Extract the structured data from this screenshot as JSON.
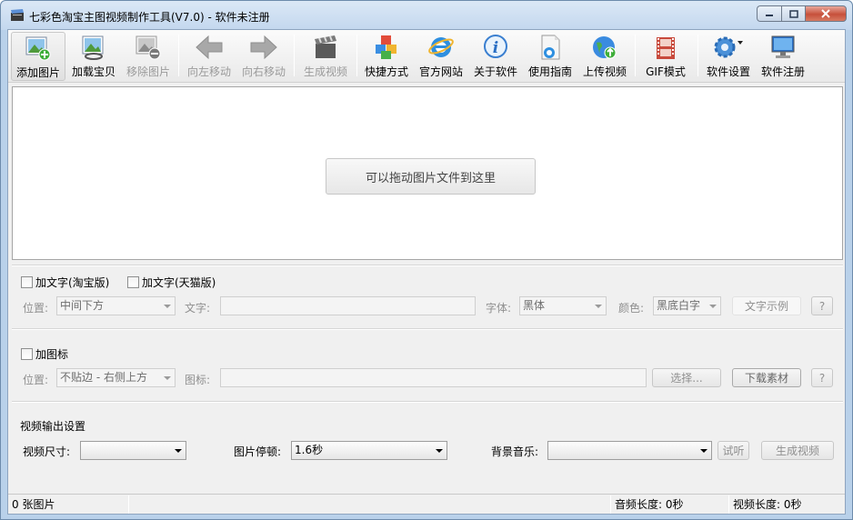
{
  "window": {
    "title": "七彩色淘宝主图视频制作工具(V7.0) - 软件未注册"
  },
  "toolbar": {
    "items": [
      {
        "label": "添加图片",
        "icon": "add-image-icon",
        "enabled": true
      },
      {
        "label": "加载宝贝",
        "icon": "load-item-icon",
        "enabled": true
      },
      {
        "label": "移除图片",
        "icon": "remove-image-icon",
        "enabled": false
      },
      {
        "label": "向左移动",
        "icon": "arrow-left-icon",
        "enabled": false
      },
      {
        "label": "向右移动",
        "icon": "arrow-right-icon",
        "enabled": false
      },
      {
        "label": "生成视频",
        "icon": "clapper-icon",
        "enabled": false
      },
      {
        "label": "快捷方式",
        "icon": "shortcut-cubes-icon",
        "enabled": true
      },
      {
        "label": "官方网站",
        "icon": "ie-browser-icon",
        "enabled": true
      },
      {
        "label": "关于软件",
        "icon": "info-icon",
        "enabled": true
      },
      {
        "label": "使用指南",
        "icon": "guide-document-icon",
        "enabled": true
      },
      {
        "label": "上传视频",
        "icon": "upload-globe-icon",
        "enabled": true
      },
      {
        "label": "GIF模式",
        "icon": "gif-film-icon",
        "enabled": true
      },
      {
        "label": "软件设置",
        "icon": "gear-icon",
        "enabled": true
      },
      {
        "label": "软件注册",
        "icon": "monitor-icon",
        "enabled": true
      }
    ]
  },
  "droparea": {
    "hint": "可以拖动图片文件到这里"
  },
  "text_section": {
    "checkbox_taobao": "加文字(淘宝版)",
    "checkbox_tmall": "加文字(天猫版)",
    "position_label": "位置:",
    "position_value": "中间下方",
    "text_label": "文字:",
    "text_value": "",
    "font_label": "字体:",
    "font_value": "黑体",
    "color_label": "颜色:",
    "color_value": "黑底白字",
    "sample_button": "文字示例",
    "help_button": "?"
  },
  "icon_section": {
    "checkbox": "加图标",
    "position_label": "位置:",
    "position_value": "不贴边 - 右侧上方",
    "icon_label": "图标:",
    "icon_value": "",
    "choose_button": "选择...",
    "download_button": "下载素材",
    "help_button": "?"
  },
  "output_section": {
    "heading": "视频输出设置",
    "size_label": "视频尺寸:",
    "size_value": "",
    "pause_label": "图片停顿:",
    "pause_value": "1.6秒",
    "music_label": "背景音乐:",
    "music_value": "",
    "listen_button": "试听",
    "generate_button": "生成视频"
  },
  "statusbar": {
    "image_count": "0 张图片",
    "audio_length": "音频长度: 0秒",
    "video_length": "视频长度: 0秒"
  },
  "colors": {
    "frame": "#b9d1ea",
    "client_bg": "#f0f0f0",
    "disabled_text": "#8f8f8f"
  }
}
